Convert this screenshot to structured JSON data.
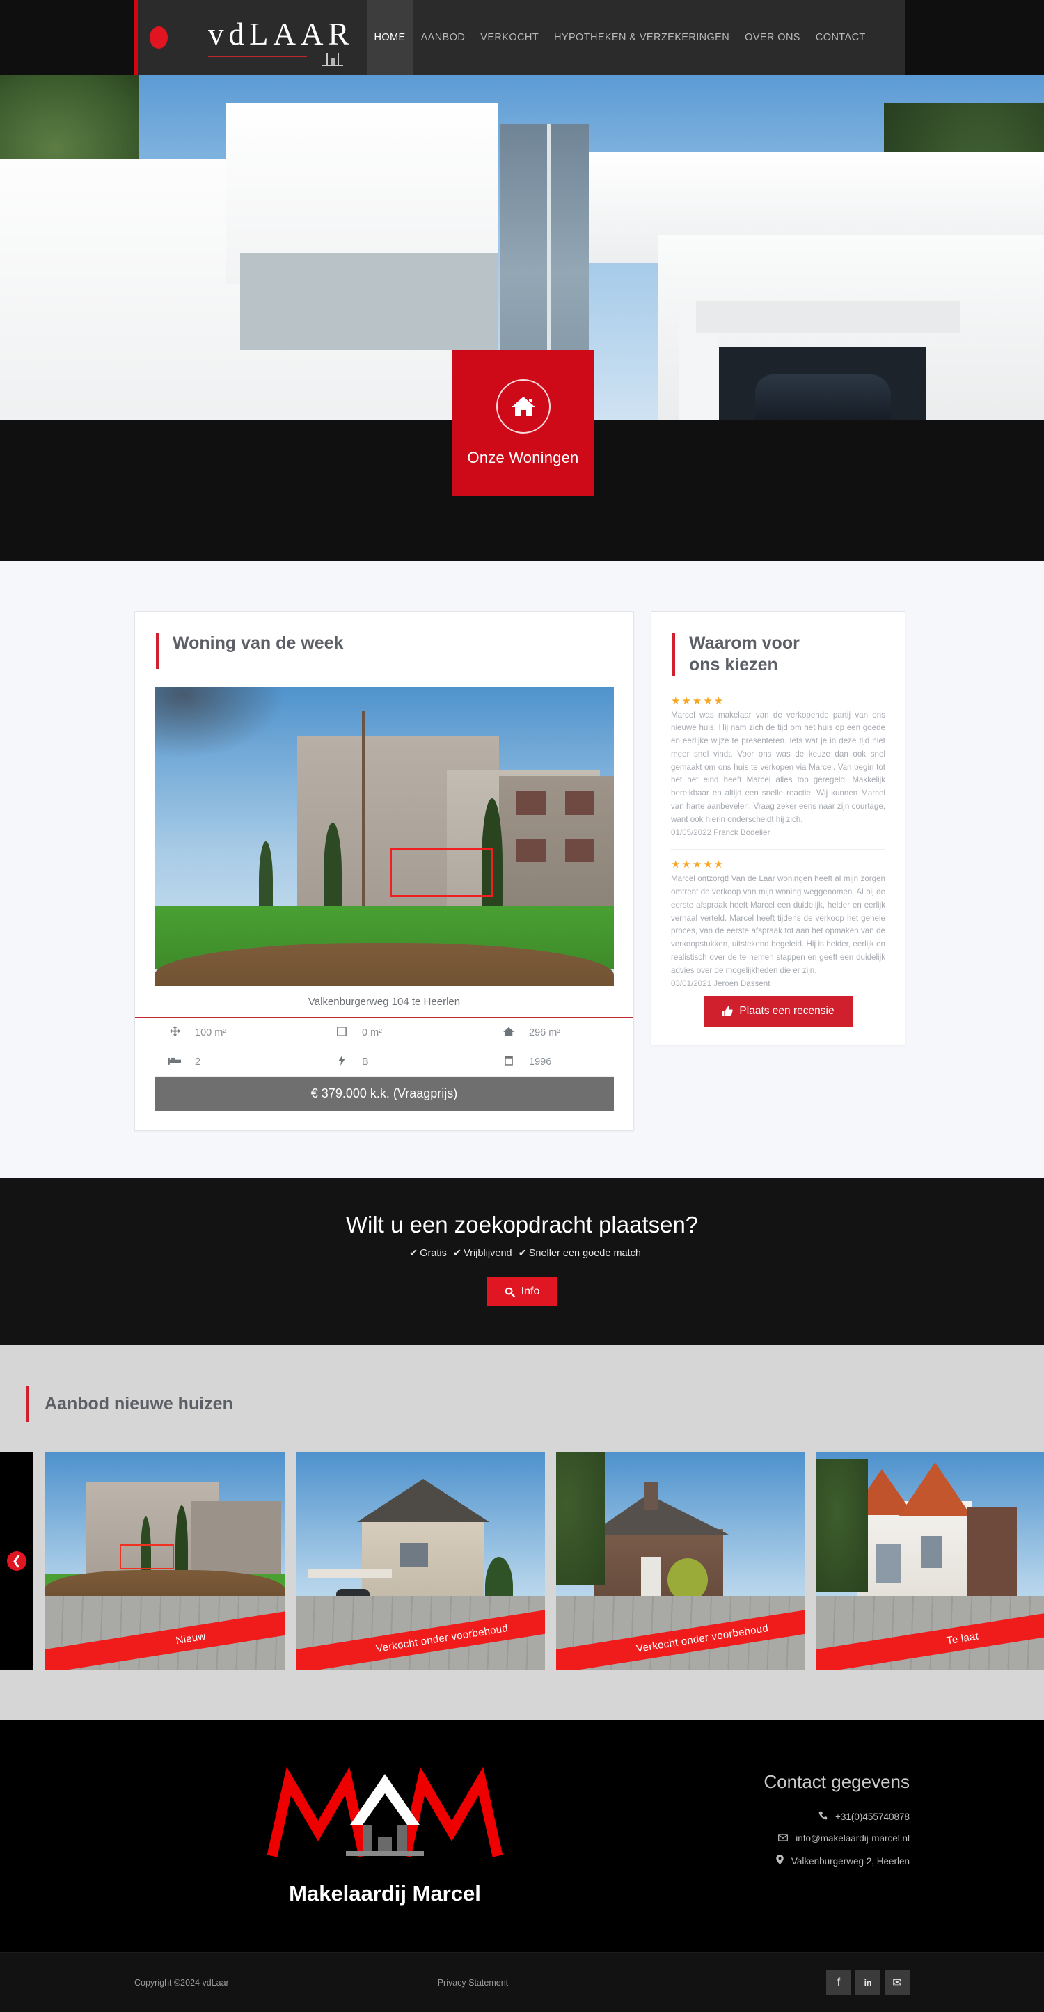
{
  "header": {
    "brand_word": "vdLAAR",
    "nav": [
      {
        "label": "HOME",
        "active": true
      },
      {
        "label": "AANBOD",
        "active": false
      },
      {
        "label": "VERKOCHT",
        "active": false
      },
      {
        "label": "HYPOTHEKEN & VERZEKERINGEN",
        "active": false
      },
      {
        "label": "OVER ONS",
        "active": false
      },
      {
        "label": "CONTACT",
        "active": false
      }
    ]
  },
  "hero": {
    "cta_label": "Onze Woningen",
    "cta_icon": "house-icon"
  },
  "week": {
    "title": "Woning van de week",
    "address": "Valkenburgerweg 104 te Heerlen",
    "specs": [
      {
        "icon": "arrows-move-icon",
        "value": "100 m²"
      },
      {
        "icon": "square-outline-icon",
        "value": "0 m²"
      },
      {
        "icon": "house-solid-icon",
        "value": "296 m³"
      },
      {
        "icon": "bed-icon",
        "value": "2"
      },
      {
        "icon": "bolt-icon",
        "value": "B"
      },
      {
        "icon": "calendar-icon",
        "value": "1996"
      }
    ],
    "price": "€ 379.000 k.k. (Vraagprijs)"
  },
  "reviews": {
    "title": "Waarom voor ons kiezen",
    "stars": "★★★★★",
    "items": [
      {
        "text": "Marcel was makelaar van de verkopende partij van ons nieuwe huis. Hij nam zich de tijd om het huis op een goede en eerlijke wijze te presenteren. Iets wat je in deze tijd niet meer snel vindt. Voor ons was de keuze dan ook snel gemaakt om ons huis te verkopen via Marcel. Van begin tot het het eind heeft Marcel alles top geregeld. Makkelijk bereikbaar en altijd een snelle reactie. Wij kunnen Marcel van harte aanbevelen. Vraag zeker eens naar zijn courtage, want ook hierin onderscheidt hij zich.",
        "signature": "01/05/2022 Franck Bodelier"
      },
      {
        "text": "Marcel ontzorgt! Van de Laar woningen heeft al mijn zorgen omtrent de verkoop van mijn woning weggenomen. Al bij de eerste afspraak heeft Marcel een duidelijk, helder en eerlijk verhaal verteld. Marcel heeft tijdens de verkoop het gehele proces, van de eerste afspraak tot aan het opmaken van de verkoopstukken, uitstekend begeleid. Hij is helder, eerlijk en realistisch over de te nemen stappen en geeft een duidelijk advies over de mogelijkheden die er zijn.",
        "signature": "03/01/2021 Jeroen Dassent"
      }
    ],
    "button_label": "Plaats een recensie",
    "button_icon": "thumbs-up-icon"
  },
  "search_cta": {
    "title": "Wilt u een zoekopdracht plaatsen?",
    "benefits": [
      "Gratis",
      "Vrijblijvend",
      "Sneller een goede match"
    ],
    "check_glyph": "✔",
    "button_label": "Info",
    "button_icon": "search-icon"
  },
  "listings": {
    "title": "Aanbod nieuwe huizen",
    "prev_icon": "chevron-left-icon",
    "next_icon": "chevron-right-icon",
    "cards": [
      {
        "ribbon": "Nieuw"
      },
      {
        "ribbon": "Verkocht onder voorbehoud"
      },
      {
        "ribbon": "Verkocht onder voorbehoud"
      },
      {
        "ribbon": "Te laat"
      }
    ]
  },
  "footer": {
    "logo_name": "Makelaardij Marcel",
    "contact_title": "Contact gegevens",
    "phone": "+31(0)455740878",
    "email": "info@makelaardij-marcel.nl",
    "address": "Valkenburgerweg 2, Heerlen",
    "phone_icon": "phone-icon",
    "email_icon": "envelope-icon",
    "address_icon": "map-pin-icon",
    "copyright": "Copyright ©2024 vdLaar",
    "privacy": "Privacy Statement",
    "social": [
      {
        "name": "facebook-icon",
        "glyph": "f"
      },
      {
        "name": "linkedin-icon",
        "glyph": "in"
      },
      {
        "name": "email-icon",
        "glyph": "✉"
      }
    ]
  },
  "colors": {
    "brand_red": "#d0202e",
    "cta_red": "#cf0a18",
    "dark": "#101010",
    "star": "#f5a623"
  }
}
